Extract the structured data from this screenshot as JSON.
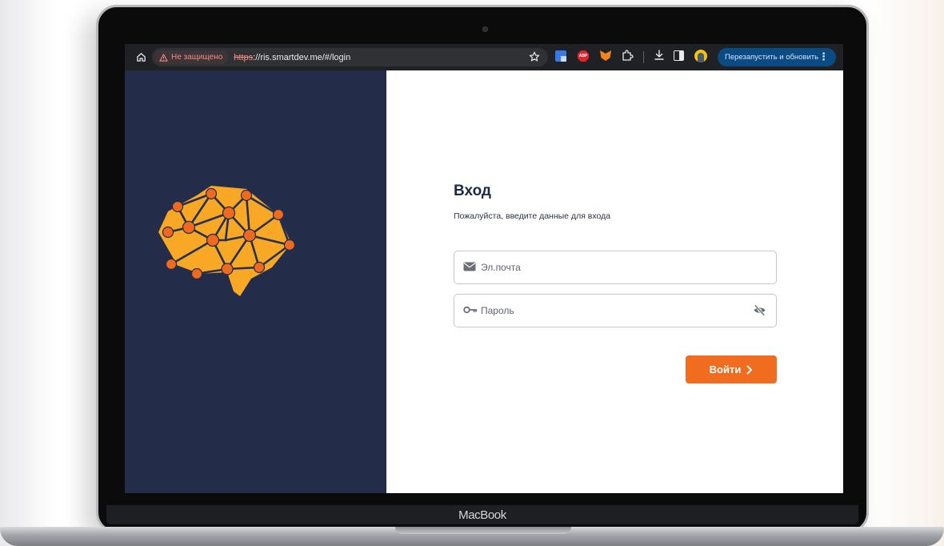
{
  "device": {
    "brand_label": "MacBook"
  },
  "browser": {
    "security_label": "Не защищено",
    "url_protocol": "https",
    "url_rest": "://ris.smartdev.me/#/login",
    "relaunch_label": "Перезапустить и обновить",
    "extensions": [
      "google-translate-icon",
      "adblock-plus-icon",
      "metamask-fox-icon"
    ],
    "colors": {
      "toolbar": "#202124",
      "relaunch_bg": "#0b4b83",
      "insecure": "#f28b82"
    }
  },
  "login": {
    "title": "Вход",
    "subtitle": "Пожалуйста, введите данные для входа",
    "email_placeholder": "Эл.почта",
    "password_placeholder": "Пароль",
    "submit_label": "Войти"
  },
  "theme": {
    "sidebar_bg": "#232c48",
    "accent": "#f06d1f",
    "logo_fill": "#f8a825",
    "logo_nodes": "#ef6a1e"
  },
  "icons": {
    "email": "envelope-icon",
    "password": "key-icon",
    "visibility": "eye-off-icon",
    "submit": "chevron-right-icon"
  }
}
